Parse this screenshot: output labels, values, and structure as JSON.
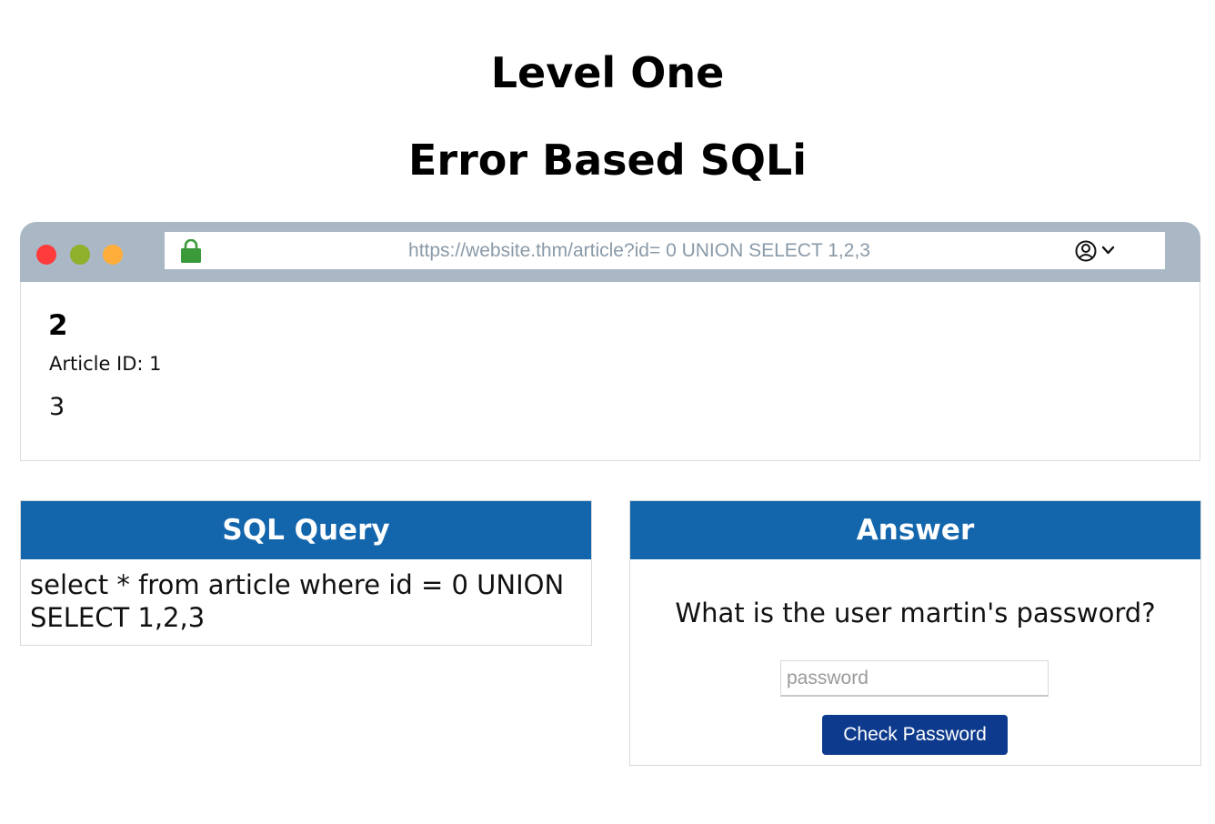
{
  "heading": {
    "level": "Level One",
    "topic": "Error Based SQLi"
  },
  "browser": {
    "url": "https://website.thm/article?id= 0 UNION SELECT 1,2,3",
    "lock_icon": "lock-icon",
    "user_icon": "user-circle-icon",
    "menu_icon": "chevron-down-icon",
    "traffic_lights": {
      "close": "#ff3b3b",
      "minimize": "#8fb02a",
      "maximize": "#ffae3b"
    }
  },
  "page": {
    "article_title": "2",
    "article_meta": "Article ID: 1",
    "article_content": "3"
  },
  "sql_panel": {
    "title": "SQL Query",
    "query": "select * from article where id = 0 UNION SELECT 1,2,3"
  },
  "answer_panel": {
    "title": "Answer",
    "question": "What is the user martin's password?",
    "password_placeholder": "password",
    "password_value": "",
    "button_label": "Check Password"
  },
  "colors": {
    "panel_header": "#1466ac",
    "button": "#0d3a8d",
    "chrome": "#aab8c5",
    "lock": "#3a9a3a"
  }
}
